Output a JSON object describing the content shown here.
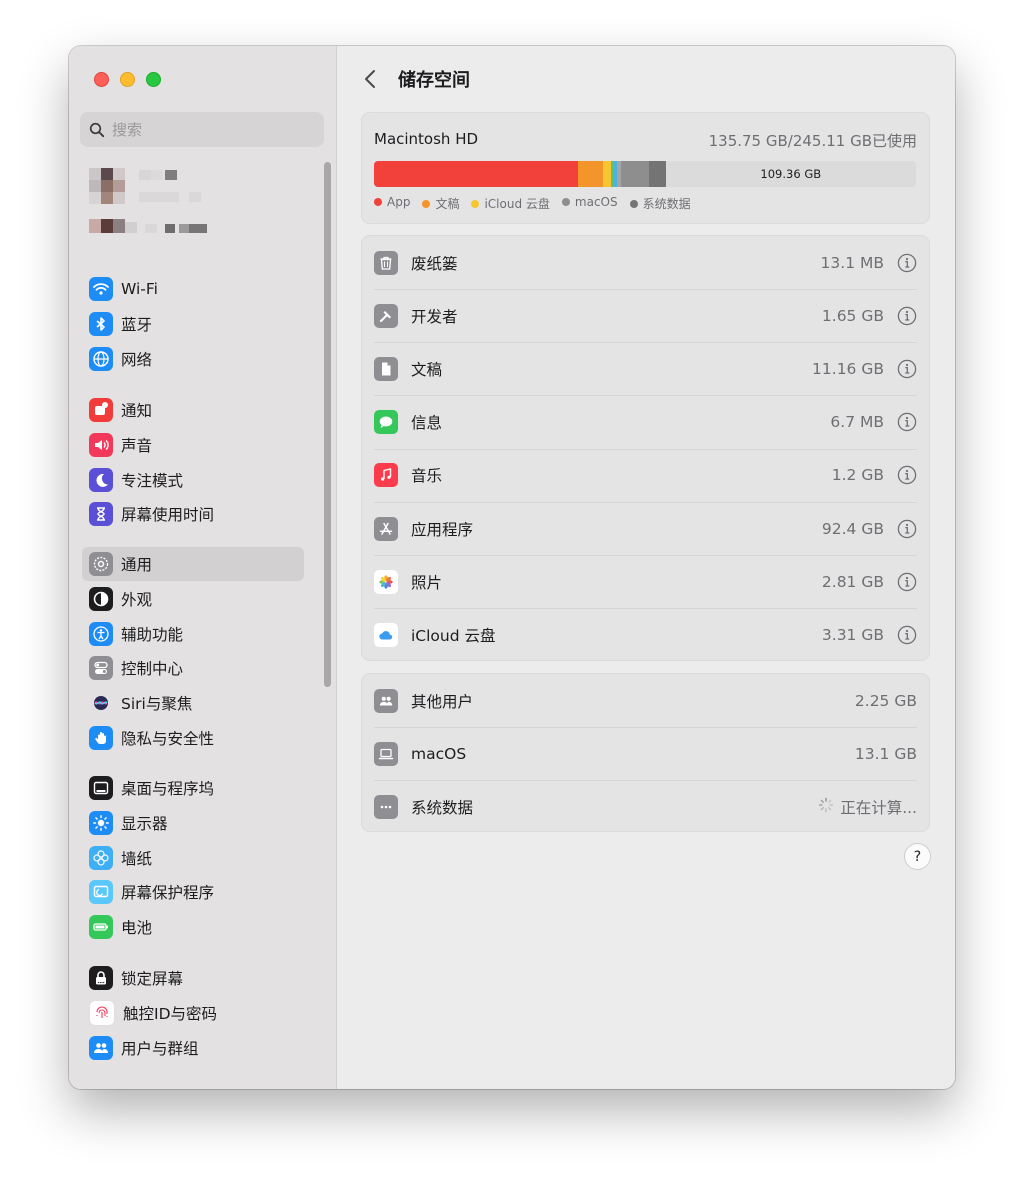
{
  "window": {
    "title": "储存空间"
  },
  "search": {
    "placeholder": "搜索"
  },
  "sidebar": {
    "groups": [
      [
        {
          "label": "Wi-Fi",
          "icon": "wifi-icon",
          "color": "#1e8cf5"
        },
        {
          "label": "蓝牙",
          "icon": "bluetooth-icon",
          "color": "#1e8cf5"
        },
        {
          "label": "网络",
          "icon": "globe-icon",
          "color": "#1e8cf5"
        }
      ],
      [
        {
          "label": "通知",
          "icon": "bell-icon",
          "color": "#f23b3b"
        },
        {
          "label": "声音",
          "icon": "speaker-icon",
          "color": "#f2395b"
        },
        {
          "label": "专注模式",
          "icon": "moon-icon",
          "color": "#5a4fd6"
        },
        {
          "label": "屏幕使用时间",
          "icon": "hourglass-icon",
          "color": "#5a4fd6"
        }
      ],
      [
        {
          "label": "通用",
          "icon": "gear-icon",
          "color": "#8e8e93",
          "active": true
        },
        {
          "label": "外观",
          "icon": "appearance-icon",
          "color": "#1d1d1f"
        },
        {
          "label": "辅助功能",
          "icon": "accessibility-icon",
          "color": "#1e8cf5"
        },
        {
          "label": "控制中心",
          "icon": "toggles-icon",
          "color": "#8e8e93"
        },
        {
          "label": "Siri与聚焦",
          "icon": "siri-icon",
          "color": "#6b3fd4"
        },
        {
          "label": "隐私与安全性",
          "icon": "hand-icon",
          "color": "#1e8cf5"
        }
      ],
      [
        {
          "label": "桌面与程序坞",
          "icon": "dock-icon",
          "color": "#1d1d1f"
        },
        {
          "label": "显示器",
          "icon": "sun-icon",
          "color": "#1e8cf5"
        },
        {
          "label": "墙纸",
          "icon": "flower-icon",
          "color": "#3eaef5"
        },
        {
          "label": "屏幕保护程序",
          "icon": "screensaver-icon",
          "color": "#5ac8fa"
        },
        {
          "label": "电池",
          "icon": "battery-icon",
          "color": "#34c759"
        }
      ],
      [
        {
          "label": "锁定屏幕",
          "icon": "lock-icon",
          "color": "#1d1d1f"
        },
        {
          "label": "触控ID与密码",
          "icon": "fingerprint-icon",
          "color": "#ffffff"
        },
        {
          "label": "用户与群组",
          "icon": "users-icon",
          "color": "#1e8cf5"
        }
      ]
    ]
  },
  "disk": {
    "name": "Macintosh HD",
    "used": "135.75 GB/245.11 GB已使用",
    "free_label": "109.36 GB",
    "segments": [
      {
        "name": "App",
        "fraction": 0.377,
        "color": "#f2403a"
      },
      {
        "name": "文稿",
        "fraction": 0.046,
        "color": "#f4952b"
      },
      {
        "name": "iCloud云盘",
        "fraction": 0.014,
        "color": "#f6c530"
      },
      {
        "name": "other-1",
        "fraction": 0.006,
        "color": "#60c36a"
      },
      {
        "name": "other-2",
        "fraction": 0.006,
        "color": "#4cb2e0"
      },
      {
        "name": "other-3",
        "fraction": 0.006,
        "color": "#a6a6a6"
      },
      {
        "name": "macOS",
        "fraction": 0.053,
        "color": "#8e8e8e"
      },
      {
        "name": "系统数据",
        "fraction": 0.03,
        "color": "#747474"
      }
    ],
    "legend": [
      {
        "label": "App",
        "color": "#f2403a"
      },
      {
        "label": "文稿",
        "color": "#f4952b"
      },
      {
        "label": "iCloud 云盘",
        "color": "#f6c530"
      },
      {
        "label": "macOS",
        "color": "#8e8e8e"
      },
      {
        "label": "系统数据",
        "color": "#747474"
      }
    ]
  },
  "categories": [
    {
      "label": "废纸篓",
      "size": "13.1 MB",
      "icon": "trash-icon"
    },
    {
      "label": "开发者",
      "size": "1.65 GB",
      "icon": "hammer-icon"
    },
    {
      "label": "文稿",
      "size": "11.16 GB",
      "icon": "document-icon"
    },
    {
      "label": "信息",
      "size": "6.7 MB",
      "icon": "messages-icon"
    },
    {
      "label": "音乐",
      "size": "1.2 GB",
      "icon": "music-icon"
    },
    {
      "label": "应用程序",
      "size": "92.4 GB",
      "icon": "appstore-icon"
    },
    {
      "label": "照片",
      "size": "2.81 GB",
      "icon": "photos-icon"
    },
    {
      "label": "iCloud 云盘",
      "size": "3.31 GB",
      "icon": "icloud-icon"
    }
  ],
  "other": [
    {
      "label": "其他用户",
      "size": "2.25 GB",
      "icon": "users-icon"
    },
    {
      "label": "macOS",
      "size": "13.1 GB",
      "icon": "laptop-icon"
    },
    {
      "label": "系统数据",
      "size": "正在计算...",
      "icon": "ellipsis-icon",
      "loading": true
    }
  ],
  "help_label": "?"
}
